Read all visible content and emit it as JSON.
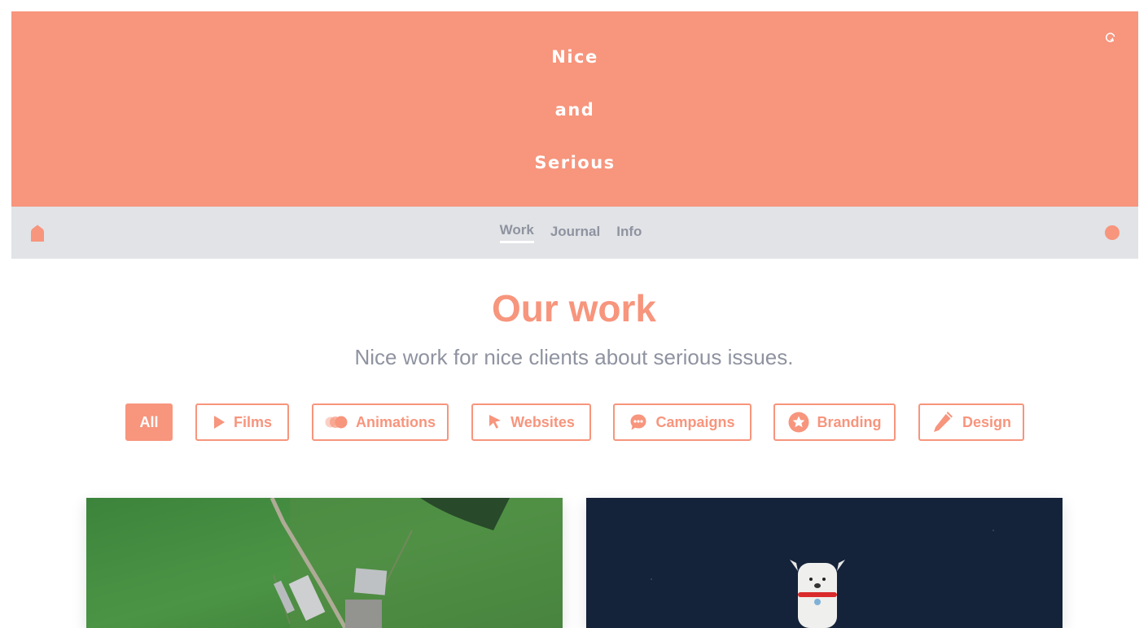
{
  "hero": {
    "lines": [
      "Nice",
      "and",
      "Serious"
    ]
  },
  "nav": {
    "links": [
      "Work",
      "Journal",
      "Info"
    ],
    "active": "Work"
  },
  "page": {
    "title": "Our work",
    "subtitle": "Nice work for nice clients about serious issues."
  },
  "filters": [
    "All",
    "Films",
    "Animations",
    "Websites",
    "Campaigns",
    "Branding",
    "Design"
  ],
  "filter_icons": [
    "",
    "play-icon",
    "animation-icon",
    "cursor-icon",
    "chat-icon",
    "star-icon",
    "pencil-icon"
  ],
  "colors": {
    "brand": "#f7957d",
    "nav_bg": "#e1e3e6",
    "nav_text": "#8f93a0",
    "text_grey": "#8f93a0"
  },
  "cards": [
    {
      "name": "aerial-farm-thumbnail"
    },
    {
      "name": "dog-illustration-thumbnail"
    }
  ]
}
